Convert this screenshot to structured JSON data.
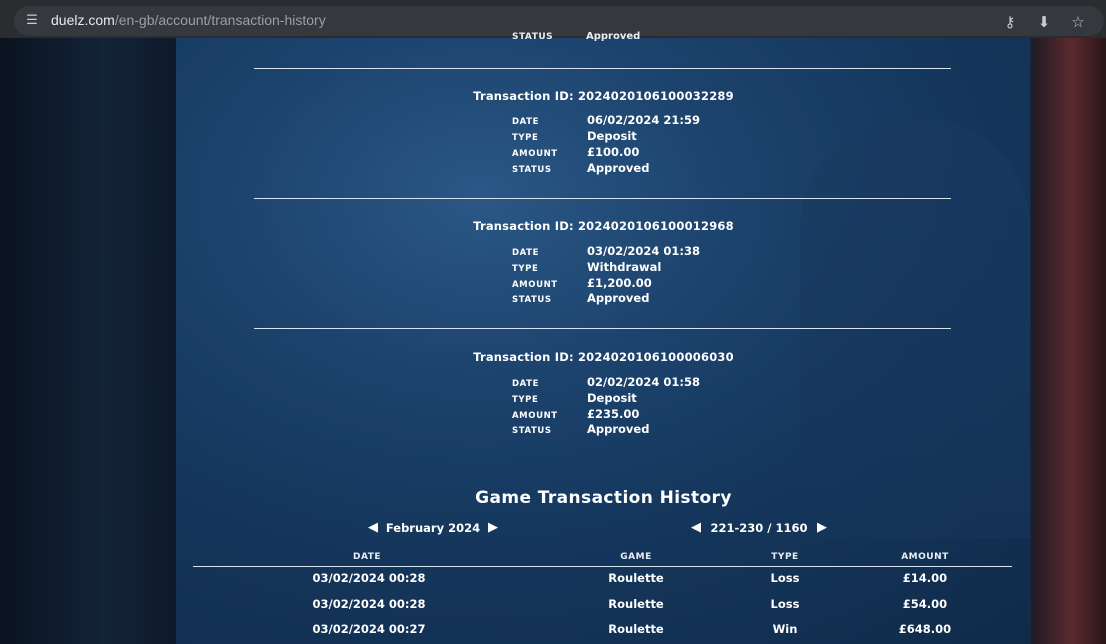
{
  "browser": {
    "url_host": "duelz.com",
    "url_path": "/en-gb/account/transaction-history",
    "icons": [
      "site-info-icon",
      "key-icon",
      "install-icon",
      "star-icon"
    ]
  },
  "partial_row": {
    "label": "STATUS",
    "value": "Approved"
  },
  "labels": {
    "date": "DATE",
    "type": "TYPE",
    "amount": "AMOUNT",
    "status": "STATUS"
  },
  "transactions": [
    {
      "id_text": "Transaction ID: 2024020106100032289",
      "date": "06/02/2024 21:59",
      "type": "Deposit",
      "amount": "£100.00",
      "status": "Approved"
    },
    {
      "id_text": "Transaction ID: 2024020106100012968",
      "date": "03/02/2024 01:38",
      "type": "Withdrawal",
      "amount": "£1,200.00",
      "status": "Approved"
    },
    {
      "id_text": "Transaction ID: 2024020106100006030",
      "date": "02/02/2024 01:58",
      "type": "Deposit",
      "amount": "£235.00",
      "status": "Approved"
    }
  ],
  "game_history": {
    "title": "Game Transaction History",
    "month": "February 2024",
    "range": "221-230 / 1160",
    "columns": [
      "DATE",
      "GAME",
      "TYPE",
      "AMOUNT"
    ],
    "rows": [
      {
        "date": "03/02/2024 00:28",
        "game": "Roulette",
        "type": "Loss",
        "amount": "£14.00"
      },
      {
        "date": "03/02/2024 00:28",
        "game": "Roulette",
        "type": "Loss",
        "amount": "£54.00"
      },
      {
        "date": "03/02/2024 00:27",
        "game": "Roulette",
        "type": "Win",
        "amount": "£648.00"
      }
    ]
  }
}
